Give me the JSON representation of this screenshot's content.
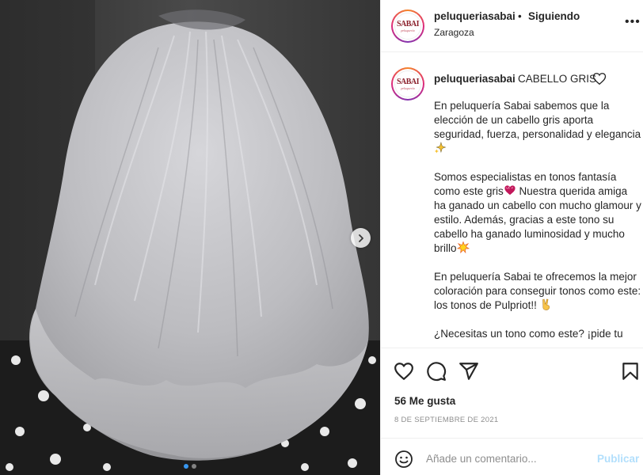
{
  "post": {
    "username": "peluqueriasabai",
    "separator": "•",
    "follow_status": "Siguiendo",
    "location": "Zaragoza",
    "more_label": "•••"
  },
  "avatar": {
    "logo_main": "SABAI",
    "logo_sub": "peluquería"
  },
  "caption": {
    "username": "peluqueriasabai",
    "title": "CABELLO GRIS",
    "p1": "En peluquería Sabai sabemos que la elección de un cabello gris aporta seguridad, fuerza, personalidad y elegancia",
    "p2a": "Somos especialistas en tonos fantasía como este gris",
    "p2b": " Nuestra querida amiga ha ganado un cabello con mucho glamour y estilo. Además, gracias a este tono su cabello ha ganado luminosidad y mucho brillo",
    "p3": "En peluquería Sabai te ofrecemos la mejor coloración para conseguir tonos como este: los tonos de Pulpriot!! ",
    "p4": "¿Necesitas un tono como este? ¡pide tu"
  },
  "icons": {
    "heart": "heart-icon",
    "comment": "comment-icon",
    "share": "share-icon",
    "save": "bookmark-icon",
    "emoji": "smile-icon",
    "next": "chevron-right-icon"
  },
  "stats": {
    "likes": "56 Me gusta",
    "date": "8 DE SEPTIEMBRE DE 2021"
  },
  "comment": {
    "placeholder": "Añade un comentario...",
    "publish_label": "Publicar"
  },
  "carousel": {
    "current_index": 1,
    "total": 2
  },
  "colors": {
    "accent": "#3897f0",
    "publish_disabled": "#b2dffc",
    "brand": "#8a1f2a"
  }
}
